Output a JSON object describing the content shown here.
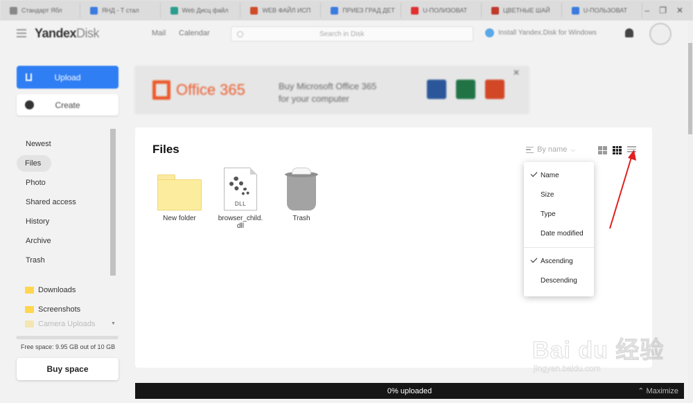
{
  "browser": {
    "tabs": [
      {
        "label": "Стандарт Ябл",
        "color": "#888888"
      },
      {
        "label": "ЯНД - Т стал",
        "color": "#3b7be0"
      },
      {
        "label": "Web Дисц файл",
        "color": "#2a9d8f"
      },
      {
        "label": "WEB ФАЙЛ ИСП",
        "color": "#d04b2a"
      },
      {
        "label": "ПРИЕЗ ГРАД ДЕТ",
        "color": "#3b7be0"
      },
      {
        "label": "U-ПОЛИЗОВАТ",
        "color": "#e03030"
      },
      {
        "label": "ЦВЕТНЫЕ ШАЙ",
        "color": "#c0392b"
      },
      {
        "label": "U-ПОЛЬЗОВАТ",
        "color": "#3b7be0"
      }
    ],
    "controls": {
      "minimize": "–",
      "maximize": "❐",
      "close": "✕"
    }
  },
  "header": {
    "logo_main": "Yandex",
    "logo_sub": "Disk",
    "links": [
      "Mail",
      "Calendar"
    ],
    "search_placeholder": "Search in Disk",
    "promo_text": "Install Yandex.Disk for Windows"
  },
  "sidebar": {
    "upload_label": "Upload",
    "create_label": "Create",
    "nav": [
      {
        "label": "Newest",
        "active": false
      },
      {
        "label": "Files",
        "active": true
      },
      {
        "label": "Photo",
        "active": false
      },
      {
        "label": "Shared access",
        "active": false
      },
      {
        "label": "History",
        "active": false
      },
      {
        "label": "Archive",
        "active": false
      },
      {
        "label": "Trash",
        "active": false
      }
    ],
    "folders": [
      "Downloads",
      "Screenshots",
      "Camera Uploads"
    ],
    "quota_used_fraction": 0.005,
    "quota_text": "Free space: 9.95 GB out of 10 GB",
    "buy_label": "Buy space"
  },
  "ad": {
    "brand": "Office 365",
    "line1": "Buy Microsoft Office 365",
    "line2": "for your computer",
    "app_colors": [
      "#2b579a",
      "#217346",
      "#d24726"
    ],
    "close": "✕"
  },
  "files_panel": {
    "title": "Files",
    "sort_label": "By name",
    "items": [
      {
        "name": "New folder",
        "kind": "folder"
      },
      {
        "name_line1": "browser_child.",
        "name_line2": "dll",
        "kind": "dll",
        "badge": "DLL"
      },
      {
        "name": "Trash",
        "kind": "trash"
      }
    ]
  },
  "sort_menu": {
    "fields": [
      {
        "label": "Name",
        "checked": true
      },
      {
        "label": "Size",
        "checked": false
      },
      {
        "label": "Type",
        "checked": false
      },
      {
        "label": "Date modified",
        "checked": false
      }
    ],
    "orders": [
      {
        "label": "Ascending",
        "checked": true
      },
      {
        "label": "Descending",
        "checked": false
      }
    ]
  },
  "upload_bar": {
    "status": "0% uploaded",
    "maximize": "Maximize"
  },
  "watermark": {
    "logo": "Bai du 经验",
    "url": "jingyan.baidu.com"
  },
  "colors": {
    "accent": "#2f7ef4",
    "annotation": "#e02020"
  }
}
